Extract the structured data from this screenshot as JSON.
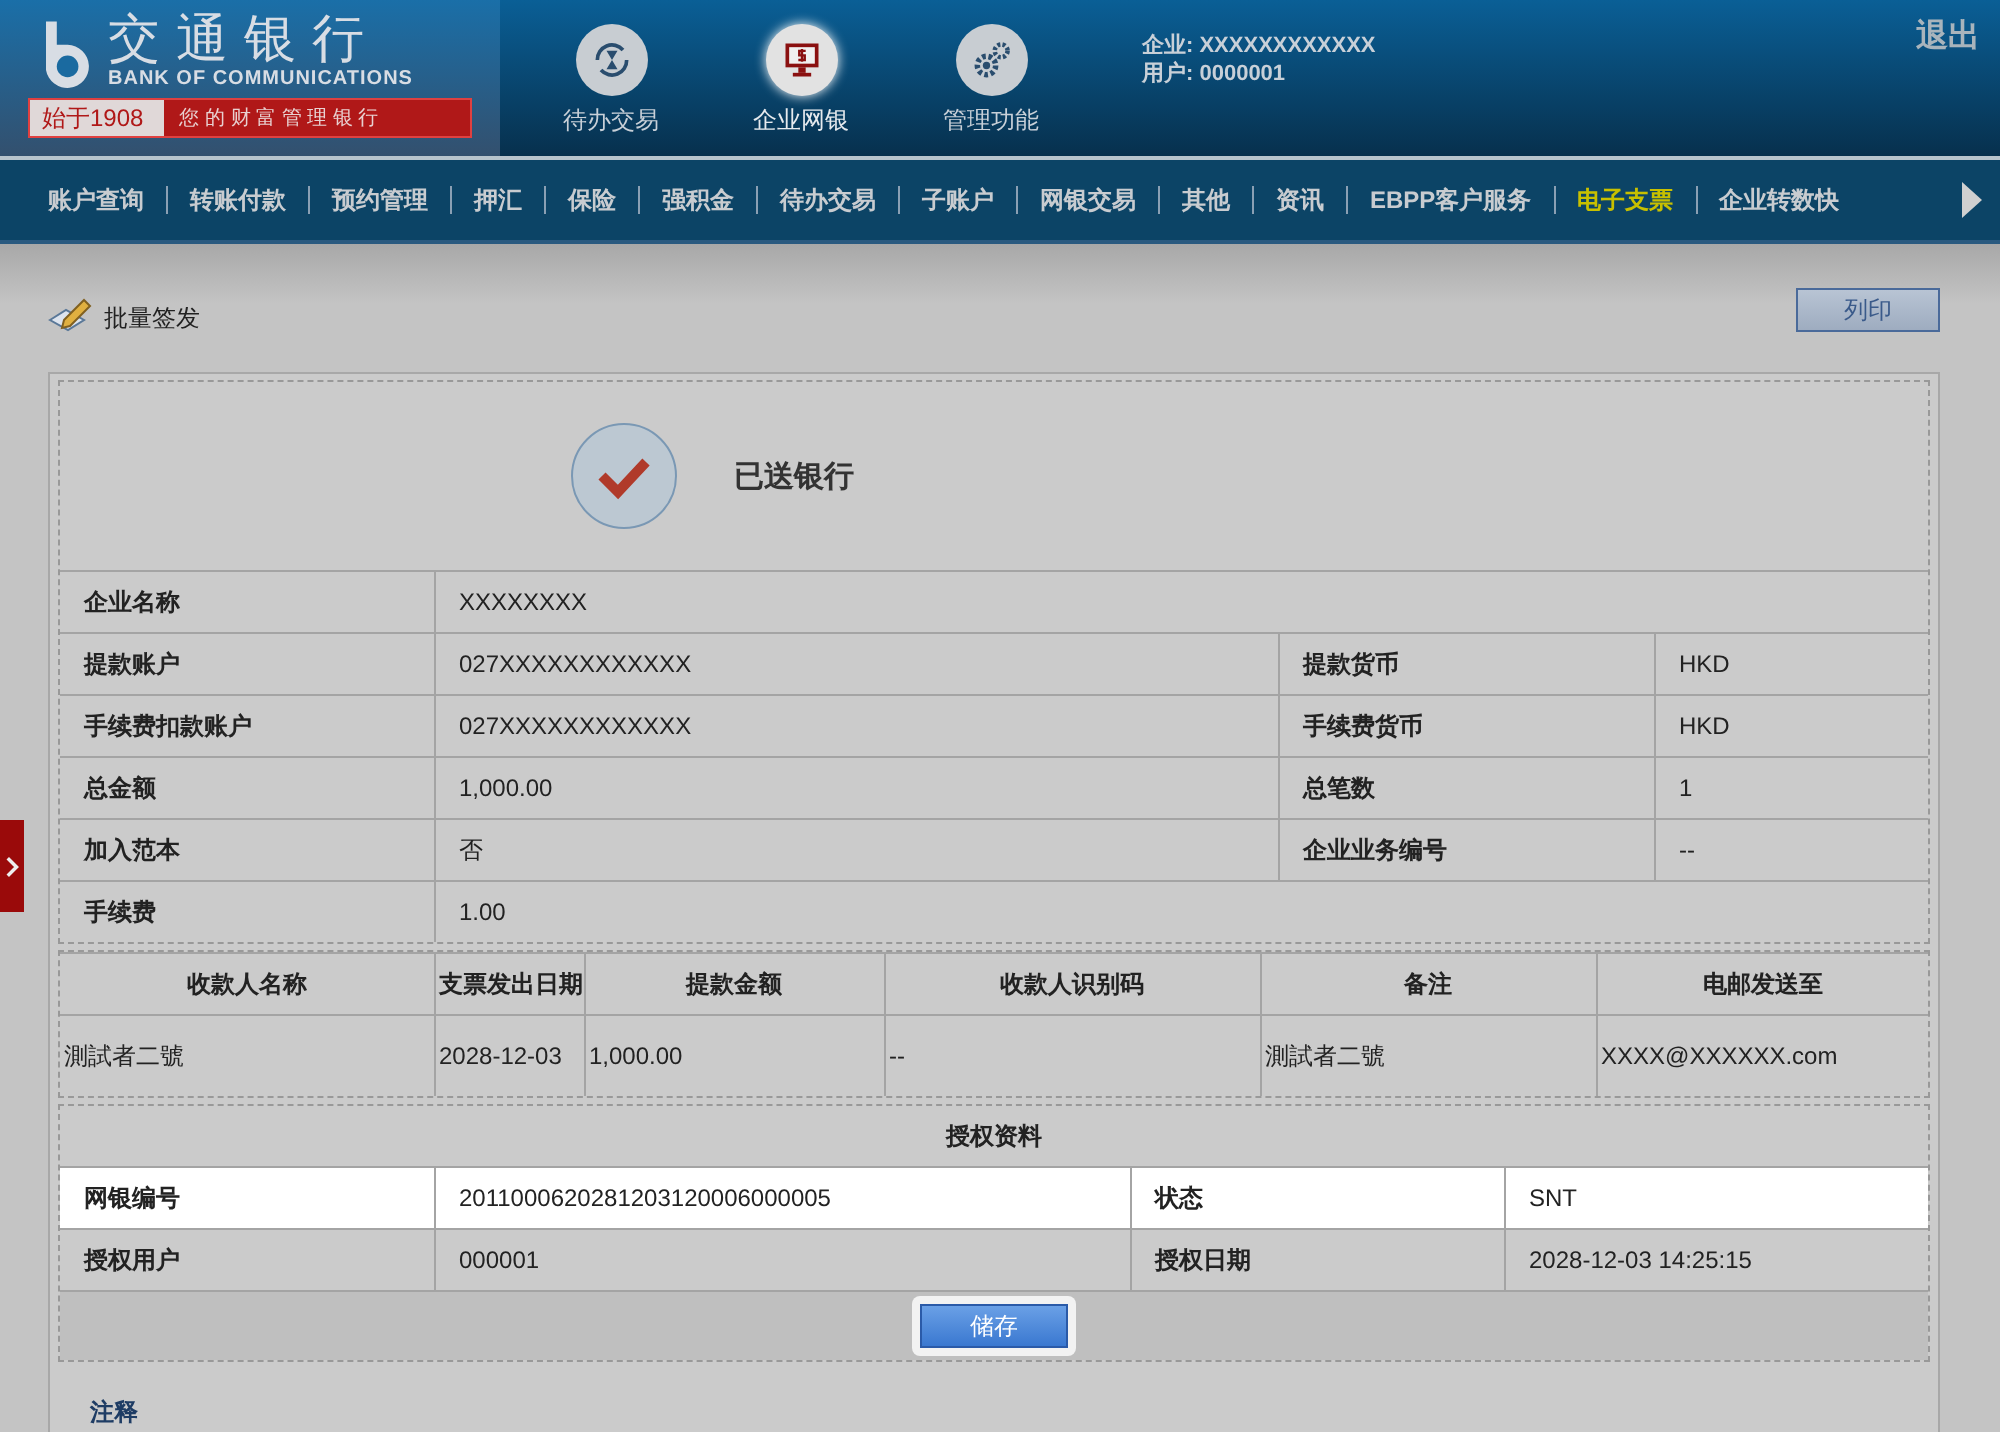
{
  "brand": {
    "name": "交通银行",
    "english": "BANK OF COMMUNICATIONS",
    "since": "始于1908",
    "slogan": "您 的 财 富 管 理 银 行"
  },
  "top_nav": [
    {
      "label": "待办交易",
      "kind": "hourglass",
      "selected": false
    },
    {
      "label": "企业网银",
      "kind": "monitor",
      "selected": true
    },
    {
      "label": "管理功能",
      "kind": "gears",
      "selected": false
    }
  ],
  "user_info": {
    "company": "企业: XXXXXXXXXXXX",
    "user": "用户: 0000001"
  },
  "logout": "退出",
  "menu": [
    {
      "label": "账户查询",
      "selected": false
    },
    {
      "label": "转账付款",
      "selected": false
    },
    {
      "label": "预约管理",
      "selected": false
    },
    {
      "label": "押汇",
      "selected": false
    },
    {
      "label": "保险",
      "selected": false
    },
    {
      "label": "强积金",
      "selected": false
    },
    {
      "label": "待办交易",
      "selected": false
    },
    {
      "label": "子账户",
      "selected": false
    },
    {
      "label": "网银交易",
      "selected": false
    },
    {
      "label": "其他",
      "selected": false
    },
    {
      "label": "资讯",
      "selected": false
    },
    {
      "label": "EBPP客户服务",
      "selected": false
    },
    {
      "label": "电子支票",
      "selected": true
    },
    {
      "label": "企业转数快",
      "selected": false
    }
  ],
  "page_title": "批量签发",
  "print_button": "列印",
  "status": "已送银行",
  "details": [
    {
      "cells": [
        {
          "label": "企业名称",
          "value": "XXXXXXXX"
        }
      ]
    },
    {
      "cells": [
        {
          "label": "提款账户",
          "value": "027XXXXXXXXXXXX"
        },
        {
          "label": "提款货币",
          "value": "HKD"
        }
      ]
    },
    {
      "cells": [
        {
          "label": "手续费扣款账户",
          "value": "027XXXXXXXXXXXX"
        },
        {
          "label": "手续费货币",
          "value": "HKD"
        }
      ]
    },
    {
      "cells": [
        {
          "label": "总金额",
          "value": "1,000.00"
        },
        {
          "label": "总笔数",
          "value": "1"
        }
      ]
    },
    {
      "cells": [
        {
          "label": "加入范本",
          "value": "否"
        },
        {
          "label": "企业业务编号",
          "value": "--"
        }
      ]
    },
    {
      "cells": [
        {
          "label": "手续费",
          "value": "1.00"
        }
      ]
    }
  ],
  "payee_table": {
    "columns": [
      "收款人名称",
      "支票发出日期",
      "提款金额",
      "收款人识别码",
      "备注",
      "电邮发送至"
    ],
    "rows": [
      [
        "測試者二號",
        "2028-12-03",
        "1,000.00",
        "--",
        "測試者二號",
        "XXXX@XXXXXX.com"
      ]
    ]
  },
  "authorization": {
    "title": "授权资料",
    "rows": [
      {
        "highlighted": true,
        "cells": [
          {
            "label": "网银编号",
            "value": "2011000620281203120006000005"
          },
          {
            "label": "状态",
            "value": "SNT"
          }
        ]
      },
      {
        "highlighted": false,
        "cells": [
          {
            "label": "授权用户",
            "value": "000001"
          },
          {
            "label": "授权日期",
            "value": "2028-12-03 14:25:15"
          }
        ]
      }
    ]
  },
  "save_button": "储存",
  "note": "注释"
}
